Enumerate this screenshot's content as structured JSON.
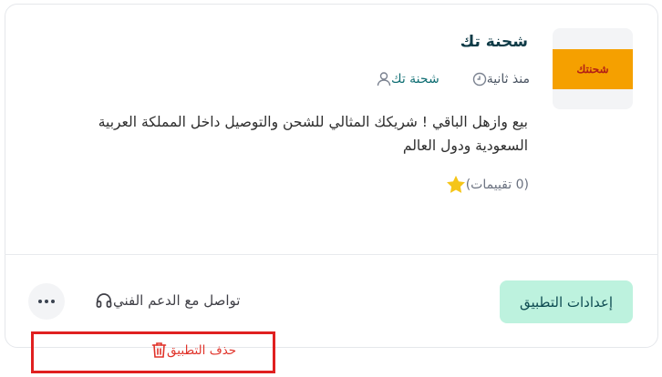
{
  "app": {
    "title": "شحنة تك",
    "logo_text": "شحنتك",
    "developer": "شحنة تك",
    "published": "منذ ثانية",
    "description": "بيع وازهل الباقي ! شريكك المثالي للشحن والتوصيل داخل المملكة العربية السعودية ودول العالم",
    "rating_text": "(0 تقييمات)",
    "rating_value": 0
  },
  "actions": {
    "settings_label": "إعدادات التطبيق",
    "support_label": "تواصل مع الدعم الفني",
    "delete_label": "حذف التطبيق"
  },
  "icons": {
    "user": "user-icon",
    "clock": "clock-icon",
    "star": "star-icon",
    "headset": "headset-icon",
    "more": "more-dots-icon",
    "trash": "trash-icon"
  },
  "colors": {
    "title": "#0f3b47",
    "accent_button_bg": "#bdf2de",
    "logo_bg": "#f5a000",
    "star": "#f5c518",
    "danger": "#e0332a",
    "highlight_border": "#e02020"
  }
}
